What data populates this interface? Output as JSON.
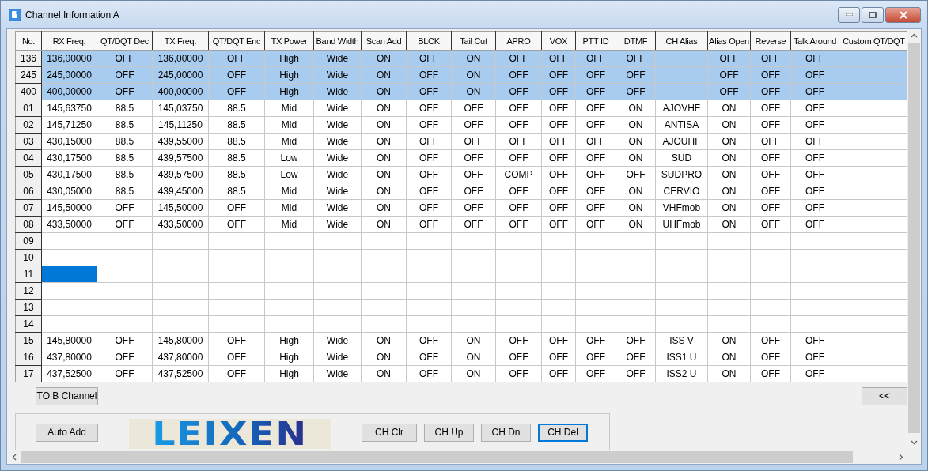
{
  "window": {
    "title": "Channel Information A"
  },
  "table": {
    "columns": [
      "No.",
      "RX Freq.",
      "QT/DQT Dec",
      "TX Freq.",
      "QT/DQT Enc",
      "TX Power",
      "Band Width",
      "Scan Add",
      "BLCK",
      "Tail Cut",
      "APRO",
      "VOX",
      "PTT ID",
      "DTMF",
      "CH Alias",
      "Alias Open",
      "Reverse",
      "Talk Around",
      "Custom QT/DQT"
    ],
    "rows": [
      {
        "selected": true,
        "cursor": false,
        "cells": [
          "136",
          "136,00000",
          "OFF",
          "136,00000",
          "OFF",
          "High",
          "Wide",
          "ON",
          "OFF",
          "ON",
          "OFF",
          "OFF",
          "OFF",
          "OFF",
          "",
          "OFF",
          "OFF",
          "OFF"
        ]
      },
      {
        "selected": true,
        "cursor": false,
        "cells": [
          "245",
          "245,00000",
          "OFF",
          "245,00000",
          "OFF",
          "High",
          "Wide",
          "ON",
          "OFF",
          "ON",
          "OFF",
          "OFF",
          "OFF",
          "OFF",
          "",
          "OFF",
          "OFF",
          "OFF"
        ]
      },
      {
        "selected": true,
        "cursor": false,
        "cells": [
          "400",
          "400,00000",
          "OFF",
          "400,00000",
          "OFF",
          "High",
          "Wide",
          "ON",
          "OFF",
          "ON",
          "OFF",
          "OFF",
          "OFF",
          "OFF",
          "",
          "OFF",
          "OFF",
          "OFF"
        ]
      },
      {
        "selected": false,
        "cursor": false,
        "cells": [
          "01",
          "145,63750",
          "88.5",
          "145,03750",
          "88.5",
          "Mid",
          "Wide",
          "ON",
          "OFF",
          "OFF",
          "OFF",
          "OFF",
          "OFF",
          "ON",
          "AJOVHF",
          "ON",
          "OFF",
          "OFF"
        ]
      },
      {
        "selected": false,
        "cursor": false,
        "cells": [
          "02",
          "145,71250",
          "88.5",
          "145,11250",
          "88.5",
          "Mid",
          "Wide",
          "ON",
          "OFF",
          "OFF",
          "OFF",
          "OFF",
          "OFF",
          "ON",
          "ANTISA",
          "ON",
          "OFF",
          "OFF"
        ]
      },
      {
        "selected": false,
        "cursor": false,
        "cells": [
          "03",
          "430,15000",
          "88.5",
          "439,55000",
          "88.5",
          "Mid",
          "Wide",
          "ON",
          "OFF",
          "OFF",
          "OFF",
          "OFF",
          "OFF",
          "ON",
          "AJOUHF",
          "ON",
          "OFF",
          "OFF"
        ]
      },
      {
        "selected": false,
        "cursor": false,
        "cells": [
          "04",
          "430,17500",
          "88.5",
          "439,57500",
          "88.5",
          "Low",
          "Wide",
          "ON",
          "OFF",
          "OFF",
          "OFF",
          "OFF",
          "OFF",
          "ON",
          "SUD",
          "ON",
          "OFF",
          "OFF"
        ]
      },
      {
        "selected": false,
        "cursor": false,
        "cells": [
          "05",
          "430,17500",
          "88.5",
          "439,57500",
          "88.5",
          "Low",
          "Wide",
          "ON",
          "OFF",
          "OFF",
          "COMP",
          "OFF",
          "OFF",
          "OFF",
          "SUDPRO",
          "ON",
          "OFF",
          "OFF"
        ]
      },
      {
        "selected": false,
        "cursor": false,
        "cells": [
          "06",
          "430,05000",
          "88.5",
          "439,45000",
          "88.5",
          "Mid",
          "Wide",
          "ON",
          "OFF",
          "OFF",
          "OFF",
          "OFF",
          "OFF",
          "ON",
          "CERVIO",
          "ON",
          "OFF",
          "OFF"
        ]
      },
      {
        "selected": false,
        "cursor": false,
        "cells": [
          "07",
          "145,50000",
          "OFF",
          "145,50000",
          "OFF",
          "Mid",
          "Wide",
          "ON",
          "OFF",
          "OFF",
          "OFF",
          "OFF",
          "OFF",
          "ON",
          "VHFmob",
          "ON",
          "OFF",
          "OFF"
        ]
      },
      {
        "selected": false,
        "cursor": false,
        "cells": [
          "08",
          "433,50000",
          "OFF",
          "433,50000",
          "OFF",
          "Mid",
          "Wide",
          "ON",
          "OFF",
          "OFF",
          "OFF",
          "OFF",
          "OFF",
          "ON",
          "UHFmob",
          "ON",
          "OFF",
          "OFF"
        ]
      },
      {
        "selected": false,
        "cursor": false,
        "cells": [
          "09"
        ]
      },
      {
        "selected": false,
        "cursor": false,
        "cells": [
          "10"
        ]
      },
      {
        "selected": false,
        "cursor": true,
        "cells": [
          "11"
        ]
      },
      {
        "selected": false,
        "cursor": false,
        "cells": [
          "12"
        ]
      },
      {
        "selected": false,
        "cursor": false,
        "cells": [
          "13"
        ]
      },
      {
        "selected": false,
        "cursor": false,
        "cells": [
          "14"
        ]
      },
      {
        "selected": false,
        "cursor": false,
        "cells": [
          "15",
          "145,80000",
          "OFF",
          "145,80000",
          "OFF",
          "High",
          "Wide",
          "ON",
          "OFF",
          "ON",
          "OFF",
          "OFF",
          "OFF",
          "OFF",
          "ISS V",
          "ON",
          "OFF",
          "OFF"
        ]
      },
      {
        "selected": false,
        "cursor": false,
        "cells": [
          "16",
          "437,80000",
          "OFF",
          "437,80000",
          "OFF",
          "High",
          "Wide",
          "ON",
          "OFF",
          "ON",
          "OFF",
          "OFF",
          "OFF",
          "OFF",
          "ISS1 U",
          "ON",
          "OFF",
          "OFF"
        ]
      },
      {
        "selected": false,
        "cursor": false,
        "cells": [
          "17",
          "437,52500",
          "OFF",
          "437,52500",
          "OFF",
          "High",
          "Wide",
          "ON",
          "OFF",
          "ON",
          "OFF",
          "OFF",
          "OFF",
          "OFF",
          "ISS2 U",
          "ON",
          "OFF",
          "OFF"
        ]
      }
    ]
  },
  "transfer_button": "TO B Channel",
  "collapse_button": "<<",
  "auto_add_button": "Auto Add",
  "logo": "LEIXEN",
  "channel_buttons": [
    {
      "label": "CH Clr",
      "focused": false
    },
    {
      "label": "CH Up",
      "focused": false
    },
    {
      "label": "CH Dn",
      "focused": false
    },
    {
      "label": "CH Del",
      "focused": true
    }
  ]
}
